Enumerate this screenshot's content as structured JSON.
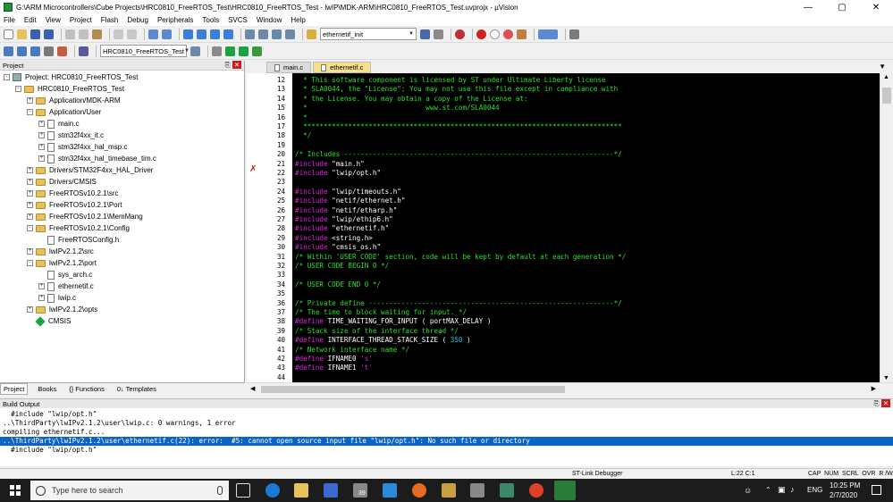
{
  "window": {
    "title": "G:\\ARM Microcontrollers\\Cube Projects\\HRC0810_FreeRTOS_Test\\HRC0810_FreeRTOS_Test - lwIP\\MDK-ARM\\HRC0810_FreeRTOS_Test.uvprojx - µVision"
  },
  "menu": [
    "File",
    "Edit",
    "View",
    "Project",
    "Flash",
    "Debug",
    "Peripherals",
    "Tools",
    "SVCS",
    "Window",
    "Help"
  ],
  "toolbar": {
    "find_combo": "ethernetif_init",
    "target_combo": "HRC0810_FreeRTOS_Test"
  },
  "project_panel": {
    "title": "Project",
    "tree": [
      {
        "label": "Project: HRC0810_FreeRTOS_Test",
        "indent": 0,
        "kind": "project",
        "exp": "-"
      },
      {
        "label": "HRC0810_FreeRTOS_Test",
        "indent": 1,
        "kind": "folder",
        "exp": "-"
      },
      {
        "label": "Application/MDK-ARM",
        "indent": 2,
        "kind": "folder",
        "exp": "+"
      },
      {
        "label": "Application/User",
        "indent": 2,
        "kind": "folder",
        "exp": "-"
      },
      {
        "label": "main.c",
        "indent": 3,
        "kind": "file",
        "exp": "+"
      },
      {
        "label": "stm32f4xx_it.c",
        "indent": 3,
        "kind": "file",
        "exp": "+"
      },
      {
        "label": "stm32f4xx_hal_msp.c",
        "indent": 3,
        "kind": "file",
        "exp": "+"
      },
      {
        "label": "stm32f4xx_hal_timebase_tim.c",
        "indent": 3,
        "kind": "file",
        "exp": "+"
      },
      {
        "label": "Drivers/STM32F4xx_HAL_Driver",
        "indent": 2,
        "kind": "folder",
        "exp": "+"
      },
      {
        "label": "Drivers/CMSIS",
        "indent": 2,
        "kind": "folder",
        "exp": "+"
      },
      {
        "label": "FreeRTOSv10.2.1\\src",
        "indent": 2,
        "kind": "folder",
        "exp": "+"
      },
      {
        "label": "FreeRTOSv10.2.1\\Port",
        "indent": 2,
        "kind": "folder",
        "exp": "+"
      },
      {
        "label": "FreeRTOSv10.2.1\\MemMang",
        "indent": 2,
        "kind": "folder",
        "exp": "+"
      },
      {
        "label": "FreeRTOSv10.2.1\\Config",
        "indent": 2,
        "kind": "folder",
        "exp": "-"
      },
      {
        "label": "FreeRTOSConfig.h",
        "indent": 3,
        "kind": "file",
        "exp": ""
      },
      {
        "label": "lwIPv2.1.2\\src",
        "indent": 2,
        "kind": "folder",
        "exp": "+"
      },
      {
        "label": "lwIPv2.1.2\\port",
        "indent": 2,
        "kind": "folder",
        "exp": "-"
      },
      {
        "label": "sys_arch.c",
        "indent": 3,
        "kind": "file",
        "exp": ""
      },
      {
        "label": "ethernetif.c",
        "indent": 3,
        "kind": "file",
        "exp": "+"
      },
      {
        "label": "lwip.c",
        "indent": 3,
        "kind": "file",
        "exp": "+"
      },
      {
        "label": "lwIPv2.1.2\\opts",
        "indent": 2,
        "kind": "folder",
        "exp": "+"
      },
      {
        "label": "CMSIS",
        "indent": 2,
        "kind": "diamond",
        "exp": ""
      }
    ],
    "tabs": [
      "Project",
      "Books",
      "{} Functions",
      "0↓ Templates"
    ]
  },
  "editor": {
    "tabs": [
      "main.c",
      "ethernetif.c"
    ],
    "active_tab": 1,
    "lines": [
      {
        "n": "12",
        "t": "  * This software component is licensed by ST under Ultimate Liberty license",
        "c": "cm"
      },
      {
        "n": "13",
        "t": "  * SLA0044, the \"License\"; You may not use this file except in compliance with",
        "c": "cm"
      },
      {
        "n": "14",
        "t": "  * the License. You may obtain a copy of the License at:",
        "c": "cm"
      },
      {
        "n": "15",
        "t": "  *                             www.st.com/SLA0044",
        "c": "cm"
      },
      {
        "n": "16",
        "t": "  *",
        "c": "cm"
      },
      {
        "n": "17",
        "t": "  ******************************************************************************",
        "c": "cm"
      },
      {
        "n": "18",
        "t": "  */",
        "c": "cm"
      },
      {
        "n": "19",
        "t": "",
        "c": "tx"
      },
      {
        "n": "20",
        "t": "/* Includes ------------------------------------------------------------------*/",
        "c": "cm"
      },
      {
        "n": "21",
        "t": "#include \"main.h\"",
        "c": "inc"
      },
      {
        "n": "22",
        "t": "#include \"lwip/opt.h\"",
        "c": "inc"
      },
      {
        "n": "23",
        "t": "",
        "c": "tx"
      },
      {
        "n": "24",
        "t": "#include \"lwip/timeouts.h\"",
        "c": "inc"
      },
      {
        "n": "25",
        "t": "#include \"netif/ethernet.h\"",
        "c": "inc"
      },
      {
        "n": "26",
        "t": "#include \"netif/etharp.h\"",
        "c": "inc"
      },
      {
        "n": "27",
        "t": "#include \"lwip/ethip6.h\"",
        "c": "inc"
      },
      {
        "n": "28",
        "t": "#include \"ethernetif.h\"",
        "c": "inc"
      },
      {
        "n": "29",
        "t": "#include <string.h>",
        "c": "inc"
      },
      {
        "n": "30",
        "t": "#include \"cmsis_os.h\"",
        "c": "inc"
      },
      {
        "n": "31",
        "t": "/* Within 'USER CODE' section, code will be kept by default at each generation */",
        "c": "cm"
      },
      {
        "n": "32",
        "t": "/* USER CODE BEGIN 0 */",
        "c": "cm"
      },
      {
        "n": "33",
        "t": "",
        "c": "tx"
      },
      {
        "n": "34",
        "t": "/* USER CODE END 0 */",
        "c": "cm"
      },
      {
        "n": "35",
        "t": "",
        "c": "tx"
      },
      {
        "n": "36",
        "t": "/* Private define ------------------------------------------------------------*/",
        "c": "cm"
      },
      {
        "n": "37",
        "t": "/* The time to block waiting for input. */",
        "c": "cm"
      },
      {
        "n": "38",
        "t": "#define TIME_WAITING_FOR_INPUT ( portMAX_DELAY )",
        "c": "def"
      },
      {
        "n": "39",
        "t": "/* Stack size of the interface thread */",
        "c": "cm"
      },
      {
        "n": "40",
        "t": "#define INTERFACE_THREAD_STACK_SIZE ( 350 )",
        "c": "defnum"
      },
      {
        "n": "41",
        "t": "/* Network interface name */",
        "c": "cm"
      },
      {
        "n": "42",
        "t": "#define IFNAME0 's'",
        "c": "defch"
      },
      {
        "n": "43",
        "t": "#define IFNAME1 't'",
        "c": "defch"
      },
      {
        "n": "44",
        "t": "",
        "c": "tx"
      }
    ]
  },
  "build_output": {
    "title": "Build Output",
    "lines": [
      "  #include \"lwip/opt.h\"",
      "..\\ThirdParty\\lwIPv2.1.2\\user\\lwip.c: 0 warnings, 1 error",
      "compiling ethernetif.c...",
      "..\\ThirdParty\\lwIPv2.1.2\\user\\ethernetif.c(22): error:  #5: cannot open source input file \"lwip/opt.h\": No such file or directory",
      "  #include \"lwip/opt.h\""
    ],
    "selected_line": 3
  },
  "status_bar": {
    "debugger": "ST-Link Debugger",
    "position": "L:22 C:1",
    "indicators": "CAP  NUM  SCRL  OVR  R /W"
  },
  "taskbar": {
    "search_placeholder": "Type here to search",
    "time": "10:25 PM",
    "date": "2/7/2020",
    "lang": "ENG",
    "mail_badge": "39"
  },
  "colors": {
    "code_bg": "#000000",
    "comment": "#28e028",
    "preproc": "#e020e0",
    "selection": "#0a64c8",
    "active_tab": "#f7e08a"
  }
}
